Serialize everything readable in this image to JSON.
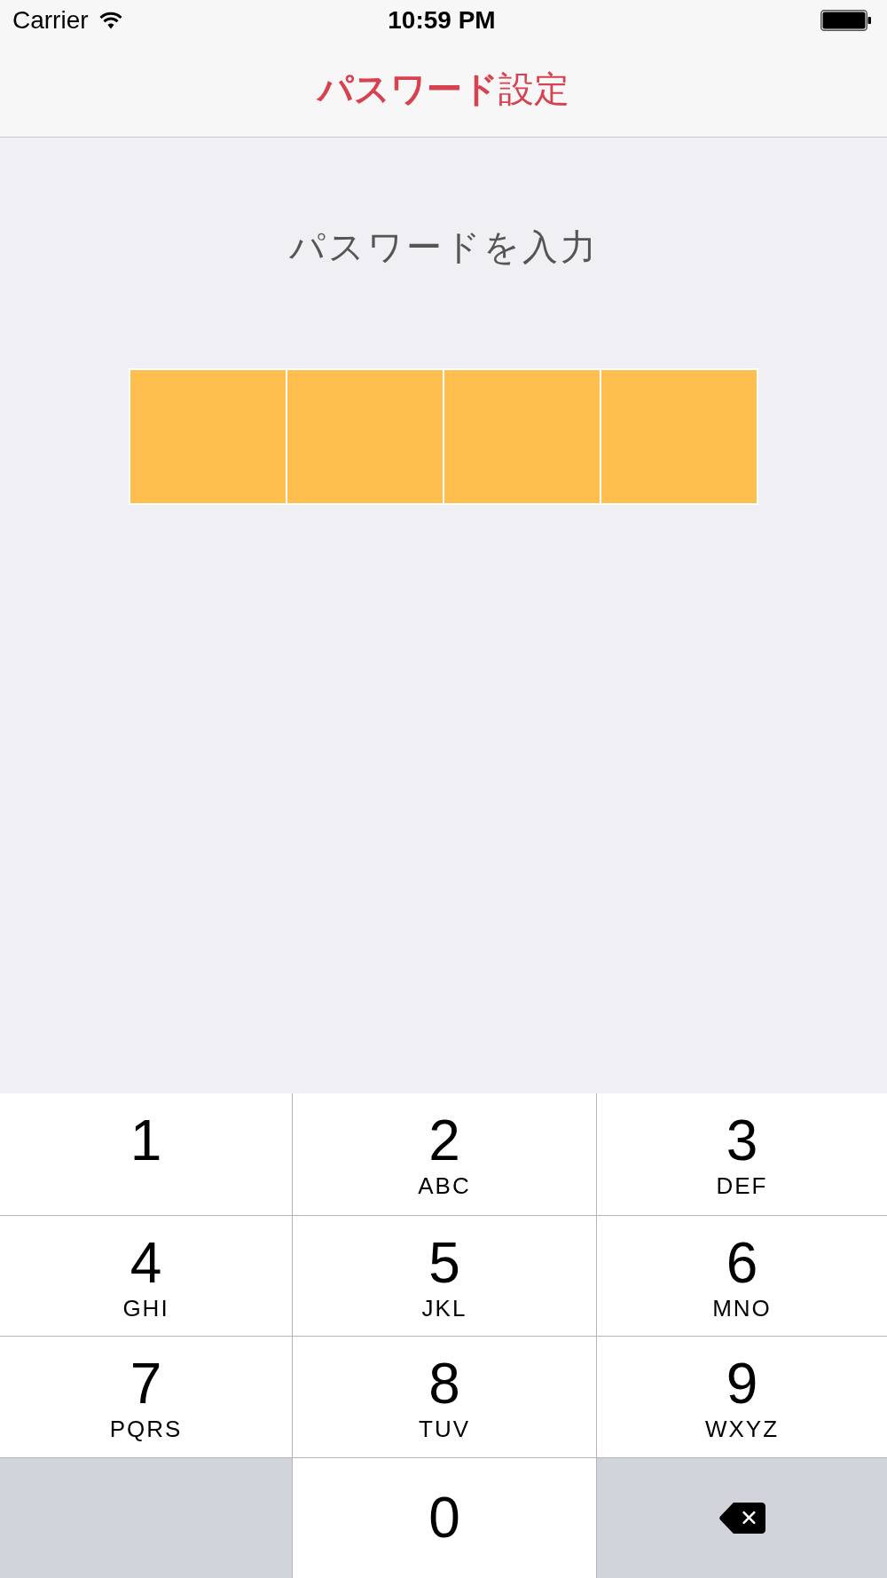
{
  "status_bar": {
    "carrier": "Carrier",
    "time": "10:59 PM"
  },
  "nav_bar": {
    "title": "**パスワード**設定"
  },
  "prompt": "パスワードを入力",
  "passcode_boxes": [
    {
      "filled": false
    },
    {
      "filled": false
    },
    {
      "filled": false
    },
    {
      "filled": false
    }
  ],
  "keypad": [
    {
      "kind": "digit",
      "digit": "1"
    },
    {
      "kind": "digit",
      "digit": "2",
      "letters": "ABC"
    },
    {
      "kind": "digit",
      "digit": "3",
      "letters": "DEF"
    },
    {
      "kind": "digit",
      "digit": "4",
      "letters": "GHI"
    },
    {
      "kind": "digit",
      "digit": "5",
      "letters": "JKL"
    },
    {
      "kind": "digit",
      "digit": "6",
      "letters": "MNO"
    },
    {
      "kind": "digit",
      "digit": "7",
      "letters": "PQRS"
    },
    {
      "kind": "digit",
      "digit": "8",
      "letters": "TUV"
    },
    {
      "kind": "digit",
      "digit": "9",
      "letters": "WXYZ"
    },
    {
      "kind": "blank"
    },
    {
      "kind": "centered_digit",
      "digit": "0"
    },
    {
      "kind": "delete"
    }
  ]
}
